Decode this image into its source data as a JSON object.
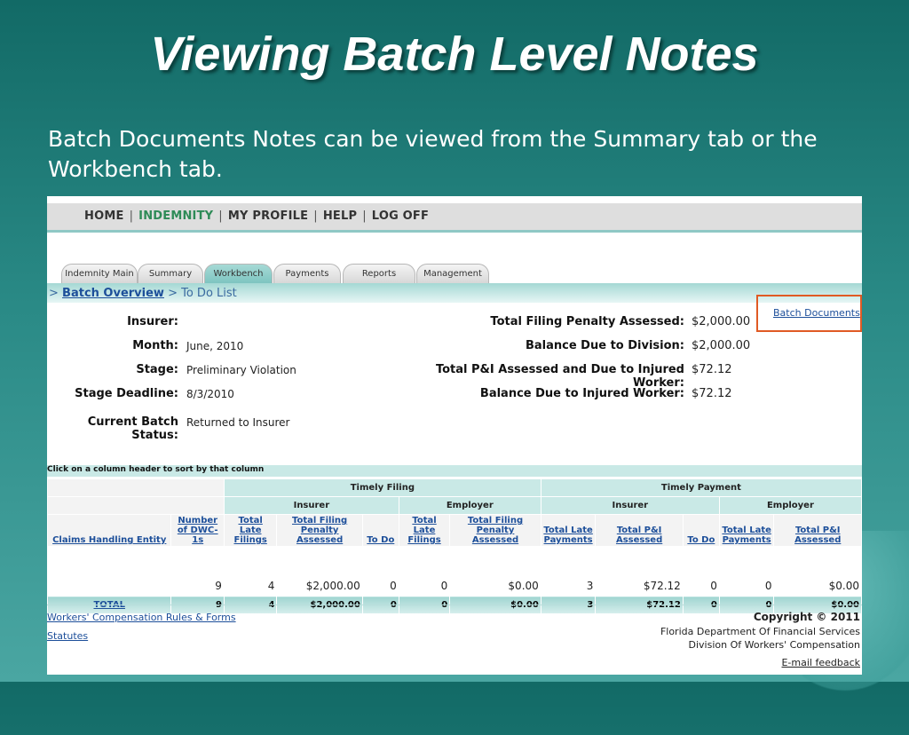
{
  "slide": {
    "title": "Viewing Batch Level Notes",
    "body": "Batch Documents Notes can be viewed from the Summary tab or the Workbench tab."
  },
  "nav": {
    "items": [
      "HOME",
      "INDEMNITY",
      "MY PROFILE",
      "HELP",
      "LOG OFF"
    ],
    "separator": "|",
    "active": "INDEMNITY"
  },
  "tabs": [
    "Indemnity Main",
    "Summary",
    "Workbench",
    "Payments",
    "Reports",
    "Management"
  ],
  "tabs_active": "Workbench",
  "breadcrumb": {
    "prefix": ">",
    "link": "Batch Overview",
    "rest": "> To Do List"
  },
  "batch_documents_link": "Batch Documents",
  "info": {
    "insurer_label": "Insurer:",
    "insurer_value": "",
    "month_label": "Month:",
    "month_value": "June, 2010",
    "stage_label": "Stage:",
    "stage_value": "Preliminary Violation",
    "deadline_label": "Stage Deadline:",
    "deadline_value": "8/3/2010",
    "status_label": "Current Batch Status:",
    "status_value": "Returned to Insurer",
    "penalty_label": "Total Filing Penalty Assessed:",
    "penalty_value": "$2,000.00",
    "due_division_label": "Balance Due to Division:",
    "due_division_value": "$2,000.00",
    "pi_label": "Total P&I Assessed and Due to Injured Worker:",
    "pi_value": "$72.12",
    "due_worker_label": "Balance Due to Injured Worker:",
    "due_worker_value": "$72.12"
  },
  "table": {
    "hint": "Click on a column header to sort by that column",
    "group_timely_filing": "Timely Filing",
    "group_timely_payment": "Timely Payment",
    "sub_insurer": "Insurer",
    "sub_employer": "Employer",
    "headers": [
      "Claims Handling Entity",
      "Number of DWC-1s",
      "Total Late Filings",
      "Total Filing Penalty Assessed",
      "To Do",
      "Total Late Filings",
      "Total Filing Penalty Assessed",
      "Total Late Payments",
      "Total P&I Assessed",
      "To Do",
      "Total Late Payments",
      "Total P&I Assessed"
    ],
    "row": [
      "",
      "9",
      "4",
      "$2,000.00",
      "0",
      "0",
      "$0.00",
      "3",
      "$72.12",
      "0",
      "0",
      "$0.00"
    ],
    "total": [
      "TOTAL",
      "9",
      "4",
      "$2,000.00",
      "0",
      "0",
      "$0.00",
      "3",
      "$72.12",
      "0",
      "0",
      "$0.00"
    ]
  },
  "footer": {
    "link_rules": "Workers' Compensation Rules & Forms",
    "link_statutes": "Statutes",
    "copyright": "Copyright © 2011",
    "org1": "Florida Department Of Financial Services",
    "org2": "Division Of Workers' Compensation",
    "feedback": "E-mail feedback"
  },
  "colors": {
    "highlight": "#e05a24",
    "link": "#1d4f9a",
    "active_nav": "#2e8b57"
  }
}
